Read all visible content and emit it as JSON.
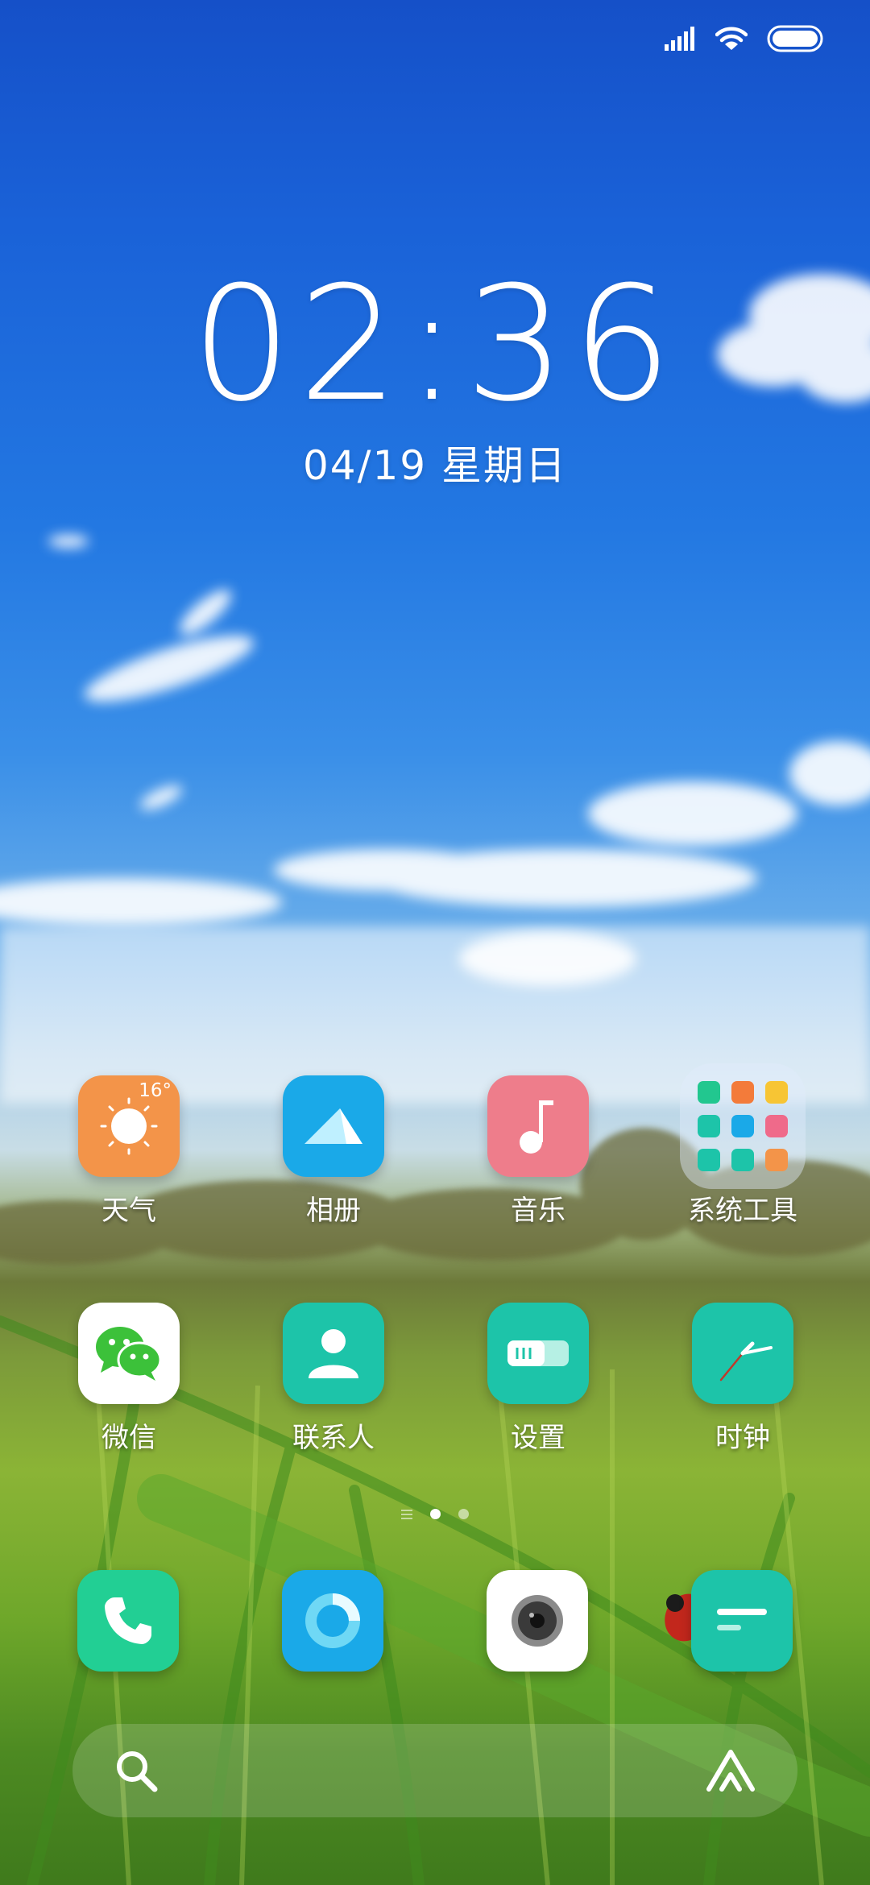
{
  "status_bar": {
    "icons": [
      "cellular-signal-icon",
      "wifi-icon",
      "battery-icon"
    ]
  },
  "lockclock": {
    "time": "02:36",
    "date": "04/19 星期日"
  },
  "apps": [
    {
      "label": "天气",
      "icon": "weather-icon",
      "badge": "16°",
      "color": "#f39449"
    },
    {
      "label": "相册",
      "icon": "gallery-icon",
      "color": "#1aa9e8"
    },
    {
      "label": "音乐",
      "icon": "music-icon",
      "color": "#ee7d8b"
    },
    {
      "label": "系统工具",
      "icon": "system-tools-folder-icon"
    },
    {
      "label": "微信",
      "icon": "wechat-icon",
      "color": "#ffffff"
    },
    {
      "label": "联系人",
      "icon": "contacts-icon",
      "color": "#1dc4a9"
    },
    {
      "label": "设置",
      "icon": "settings-icon",
      "color": "#1dc4a9"
    },
    {
      "label": "时钟",
      "icon": "clock-icon",
      "color": "#1dc4a9"
    }
  ],
  "pager": {
    "pages": 2,
    "active": 1
  },
  "dock": [
    {
      "icon": "phone-icon",
      "color": "#22cf94"
    },
    {
      "icon": "browser-icon",
      "color": "#1aa9e8"
    },
    {
      "icon": "camera-icon",
      "color": "#ffffff"
    },
    {
      "icon": "messages-icon",
      "color": "#1dc4a9"
    }
  ],
  "search_bar": {
    "left_icon": "search-icon",
    "right_icon": "assistant-icon"
  }
}
